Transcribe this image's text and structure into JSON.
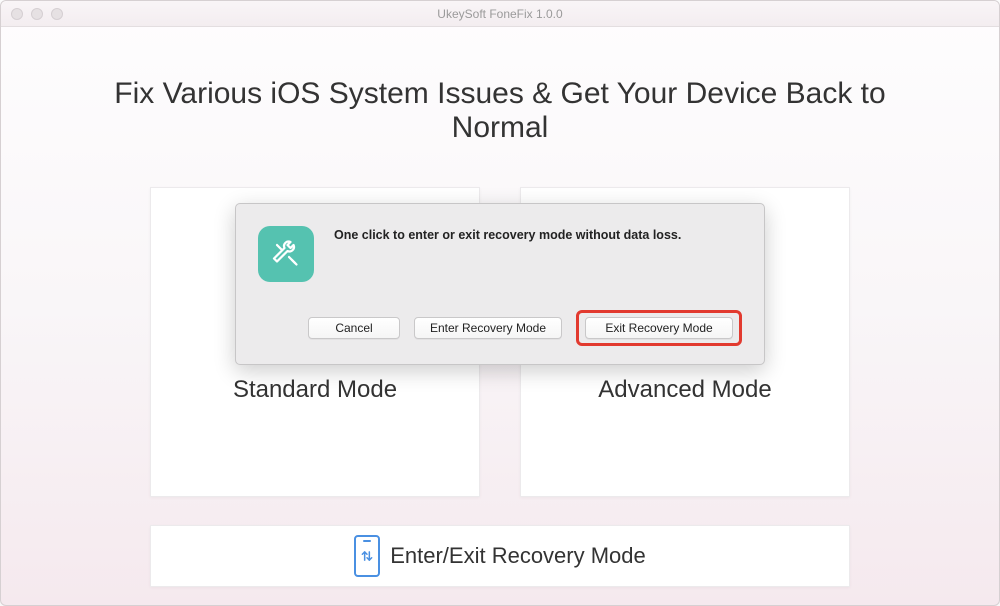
{
  "window": {
    "title": "UkeySoft FoneFix 1.0.0"
  },
  "main": {
    "heading": "Fix Various iOS System Issues & Get Your Device Back to Normal",
    "cards": {
      "standard": {
        "label": "Standard Mode"
      },
      "advanced": {
        "label": "Advanced Mode"
      }
    },
    "recovery": {
      "label": "Enter/Exit Recovery Mode"
    }
  },
  "dialog": {
    "message": "One click to enter or exit recovery mode without data loss.",
    "buttons": {
      "cancel": "Cancel",
      "enter": "Enter Recovery Mode",
      "exit": "Exit Recovery Mode"
    }
  }
}
